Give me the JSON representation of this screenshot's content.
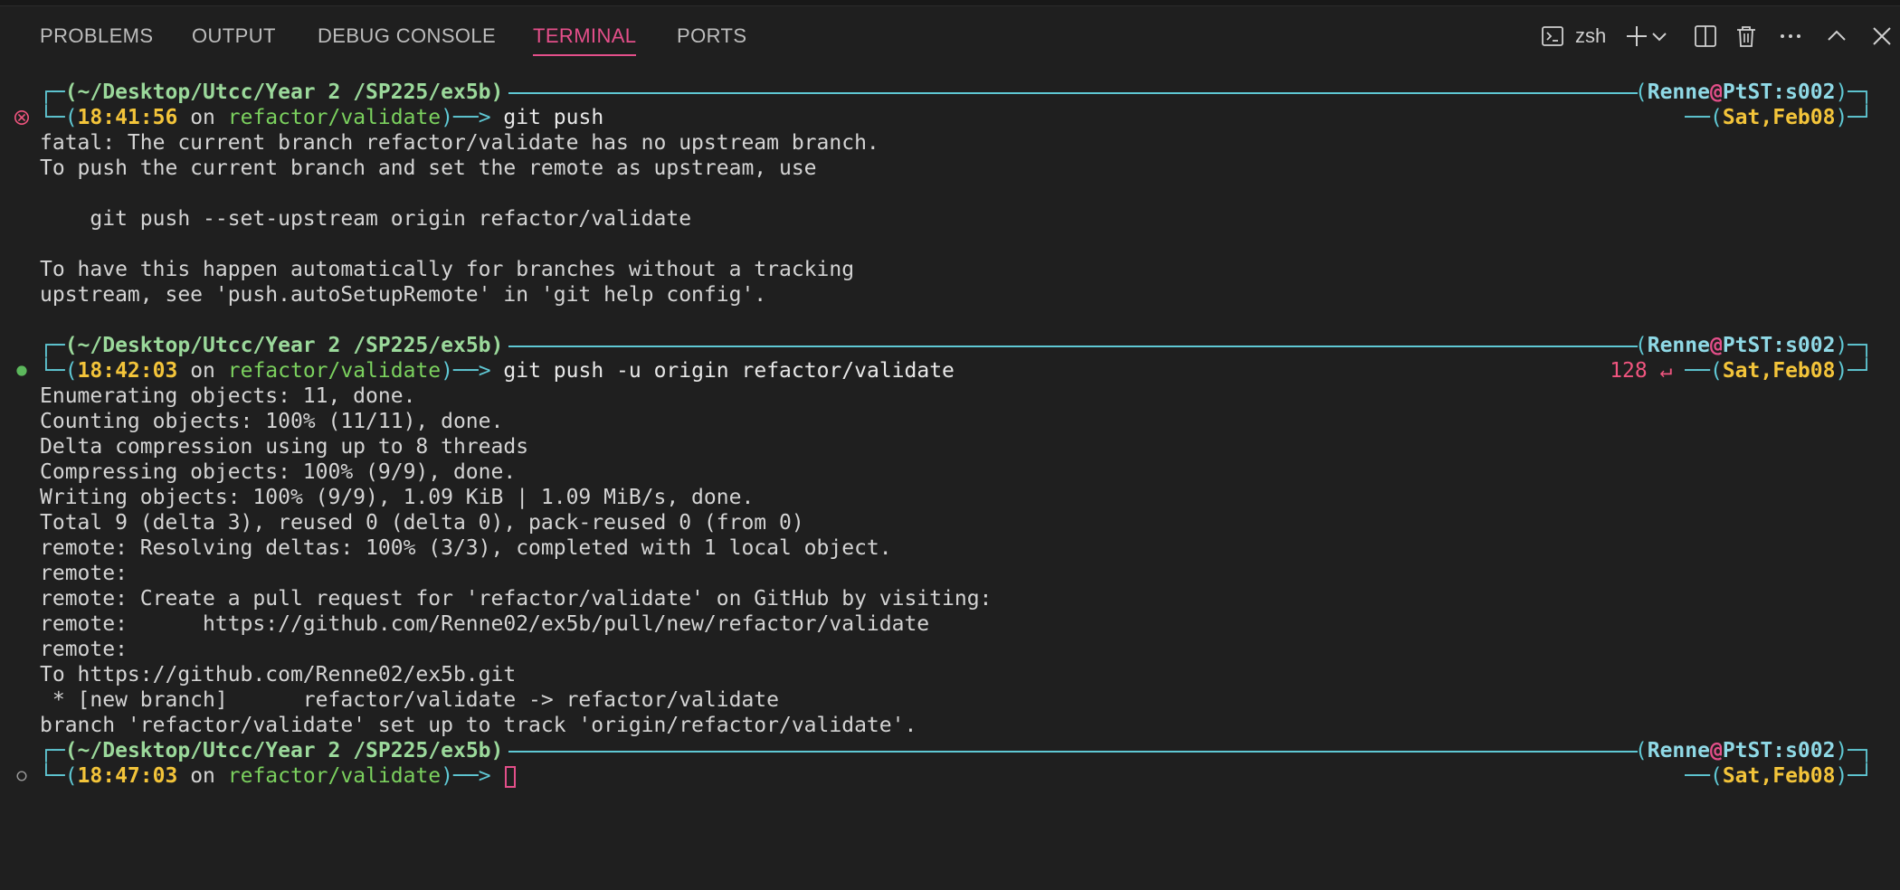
{
  "panel": {
    "tabs": [
      {
        "label": "PROBLEMS"
      },
      {
        "label": "OUTPUT"
      },
      {
        "label": "DEBUG CONSOLE"
      },
      {
        "label": "TERMINAL"
      },
      {
        "label": "PORTS"
      }
    ],
    "active_tab": "TERMINAL",
    "shell_name": "zsh",
    "accent_color": "#e44f8a"
  },
  "prompts": [
    {
      "path": "(~/Desktop/Utcc/Year 2 /SP225/ex5b)",
      "time": "18:41:56",
      "on": "on",
      "branch": "refactor/validate",
      "command": "git push",
      "user": "Renne",
      "at": "@",
      "host": "PtST:s002",
      "date": "Sat,Feb08",
      "status": "error",
      "exit_code": ""
    },
    {
      "path": "(~/Desktop/Utcc/Year 2 /SP225/ex5b)",
      "time": "18:42:03",
      "on": "on",
      "branch": "refactor/validate",
      "command": "git push -u origin refactor/validate",
      "user": "Renne",
      "at": "@",
      "host": "PtST:s002",
      "date": "Sat,Feb08",
      "status": "success",
      "exit_code": "128 ↵"
    },
    {
      "path": "(~/Desktop/Utcc/Year 2 /SP225/ex5b)",
      "time": "18:47:03",
      "on": "on",
      "branch": "refactor/validate",
      "command": "",
      "user": "Renne",
      "at": "@",
      "host": "PtST:s002",
      "date": "Sat,Feb08",
      "status": "idle",
      "exit_code": ""
    }
  ],
  "output1": [
    "fatal: The current branch refactor/validate has no upstream branch.",
    "To push the current branch and set the remote as upstream, use",
    "",
    "    git push --set-upstream origin refactor/validate",
    "",
    "To have this happen automatically for branches without a tracking",
    "upstream, see 'push.autoSetupRemote' in 'git help config'.",
    ""
  ],
  "output2": [
    "Enumerating objects: 11, done.",
    "Counting objects: 100% (11/11), done.",
    "Delta compression using up to 8 threads",
    "Compressing objects: 100% (9/9), done.",
    "Writing objects: 100% (9/9), 1.09 KiB | 1.09 MiB/s, done.",
    "Total 9 (delta 3), reused 0 (delta 0), pack-reused 0 (from 0)",
    "remote: Resolving deltas: 100% (3/3), completed with 1 local object.",
    "remote:",
    "remote: Create a pull request for 'refactor/validate' on GitHub by visiting:",
    "remote:      https://github.com/Renne02/ex5b/pull/new/refactor/validate",
    "remote:",
    "To https://github.com/Renne02/ex5b.git",
    " * [new branch]      refactor/validate -> refactor/validate",
    "branch 'refactor/validate' set up to track 'origin/refactor/validate'."
  ]
}
